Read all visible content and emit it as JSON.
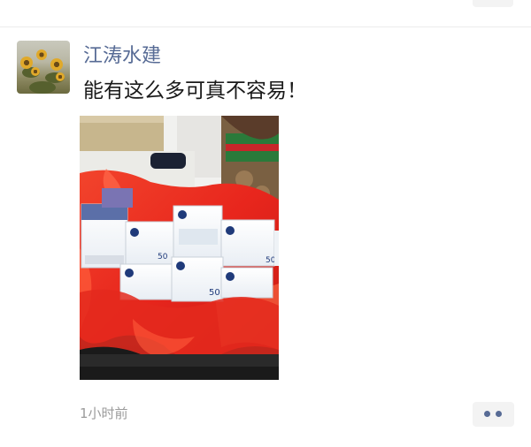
{
  "post": {
    "author": "江涛水建",
    "text": "能有这么多可真不容易！",
    "photo_box_label": "50",
    "time": "1小时前"
  },
  "icons": {
    "avatar": "sunflower-avatar-image",
    "more": "more-dots-icon"
  },
  "colors": {
    "author_name": "#576b95",
    "body_text": "#1a1a1a",
    "timestamp": "#9b9b9b",
    "more_button_bg": "#f3f3f3",
    "more_dots": "#576b95"
  }
}
